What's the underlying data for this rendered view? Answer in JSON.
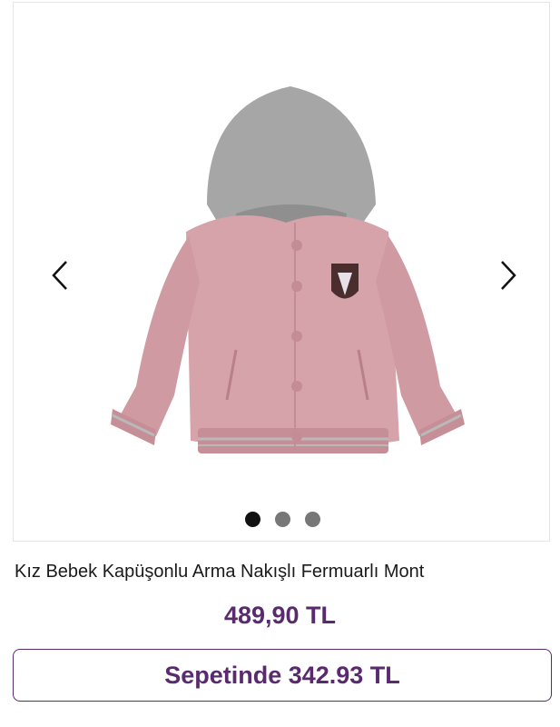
{
  "product": {
    "title": "Kız Bebek Kapüşonlu Arma Nakışlı Fermuarlı Mont",
    "price": "489,90 TL",
    "basket_price_label": "Sepetinde 342.93 TL",
    "image_alt": "pink hooded baby jacket with gray hood and embroidered crest"
  },
  "carousel": {
    "prev_icon": "chevron-left-icon",
    "next_icon": "chevron-right-icon",
    "slide_count": 3,
    "active_index": 0
  },
  "colors": {
    "accent": "#5a2a6e",
    "jacket": "#d6a3ab",
    "hood": "#a6a6a6"
  }
}
